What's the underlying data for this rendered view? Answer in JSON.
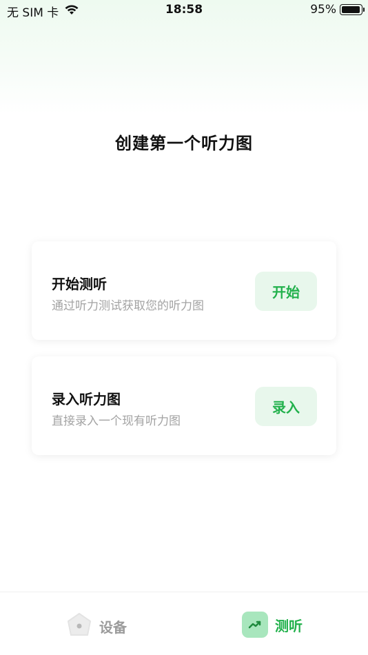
{
  "status_bar": {
    "carrier": "无 SIM 卡",
    "time": "18:58",
    "battery": "95%",
    "battery_level": 0.95
  },
  "page": {
    "title": "创建第一个听力图"
  },
  "cards": [
    {
      "title": "开始测听",
      "subtitle": "通过听力测试获取您的听力图",
      "button": "开始"
    },
    {
      "title": "录入听力图",
      "subtitle": "直接录入一个现有听力图",
      "button": "录入"
    }
  ],
  "tabbar": {
    "items": [
      {
        "label": "设备",
        "icon": "device-pentagon-icon",
        "active": false
      },
      {
        "label": "测听",
        "icon": "trend-up-icon",
        "active": true
      }
    ]
  },
  "colors": {
    "accent": "#22b14c",
    "accent_bg": "#e8f7ec",
    "muted_text": "#a3a3a3"
  }
}
